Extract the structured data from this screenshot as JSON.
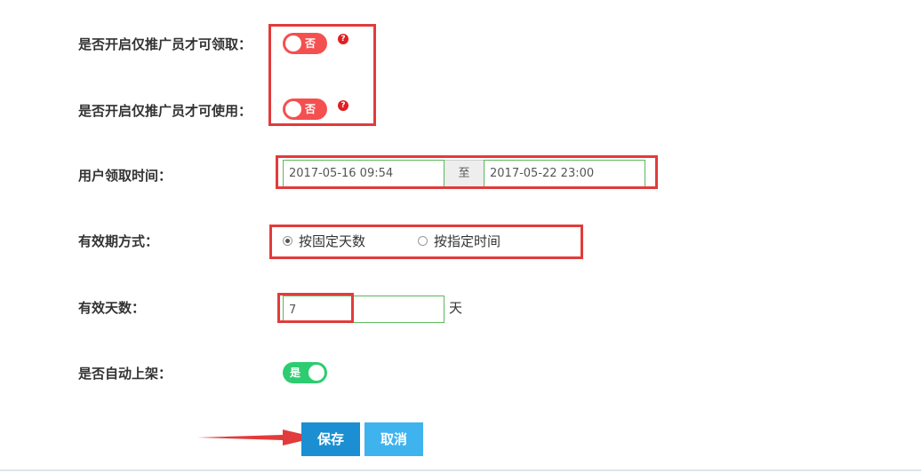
{
  "form": {
    "promoter_receive": {
      "label": "是否开启仅推广员才可领取：",
      "toggle_text": "否",
      "help": "?"
    },
    "promoter_use": {
      "label": "是否开启仅推广员才可使用：",
      "toggle_text": "否",
      "help": "?"
    },
    "receive_time": {
      "label": "用户领取时间：",
      "start": "2017-05-16 09:54",
      "separator": "至",
      "end": "2017-05-22 23:00"
    },
    "validity_mode": {
      "label": "有效期方式：",
      "options": [
        {
          "label": "按固定天数",
          "checked": true
        },
        {
          "label": "按指定时间",
          "checked": false
        }
      ]
    },
    "valid_days": {
      "label": "有效天数：",
      "value": "7",
      "unit": "天"
    },
    "auto_shelf": {
      "label": "是否自动上架：",
      "toggle_text": "是"
    }
  },
  "actions": {
    "save_label": "保存",
    "cancel_label": "取消"
  },
  "colors": {
    "highlight": "#e23b3b",
    "toggle_off": "#f45050",
    "toggle_on": "#2ecc71",
    "primary": "#1b8fd1",
    "secondary": "#3eb3ee",
    "field_border": "#5cb85c"
  }
}
